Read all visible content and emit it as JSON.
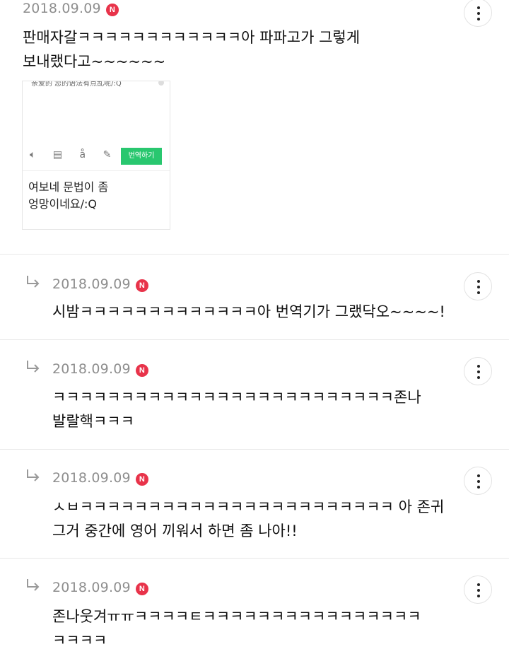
{
  "main_comment": {
    "date": "2018.09.09",
    "badge": "N",
    "text_line1": "판매자갈ㅋㅋㅋㅋㅋㅋㅋㅋㅋㅋㅋㅋ아 파파고가 그렇게",
    "text_line2": "보내랬다고~~~~~~",
    "attachment": {
      "snippet": "亲爱的 您的语法有点乱呢/:Q",
      "translate_button": "번역하기",
      "caption_line1": "여보네 문법이 좀",
      "caption_line2": "엉망이네요/:Q"
    }
  },
  "replies": [
    {
      "date": "2018.09.09",
      "badge": "N",
      "text_line1": "시밤ㅋㅋㅋㅋㅋㅋㅋㅋㅋㅋㅋㅋㅋ아 번역기가 그랬닥오~~~~!",
      "text_line2": ""
    },
    {
      "date": "2018.09.09",
      "badge": "N",
      "text_line1": "ㅋㅋㅋㅋㅋㅋㅋㅋㅋㅋㅋㅋㅋㅋㅋㅋㅋㅋㅋㅋㅋㅋㅋㅋㅋ존나",
      "text_line2": "발랄핵ㅋㅋㅋ"
    },
    {
      "date": "2018.09.09",
      "badge": "N",
      "text_line1": "ㅅㅂㅋㅋㅋㅋㅋㅋㅋㅋㅋㅋㅋㅋㅋㅋㅋㅋㅋㅋㅋㅋㅋㅋㅋ 아 존귀",
      "text_line2": "그거 중간에 영어 끼워서 하면 좀 나아!!"
    },
    {
      "date": "2018.09.09",
      "badge": "N",
      "text_line1": "존나웃겨ㅠㅠㅋㅋㅋㅋㅌㅋㅋㅋㅋㅋㅋㅋㅋㅋㅋㅋㅋㅋㅋㅋㅋ",
      "text_line2": "ㅋㅋㅋㅋ"
    }
  ],
  "icons": {
    "more": "more-vertical-icon",
    "reply": "reply-arrow-icon"
  },
  "colors": {
    "badge": "#e8334a",
    "translate_button": "#29c76f",
    "date": "#8e8e8e"
  }
}
